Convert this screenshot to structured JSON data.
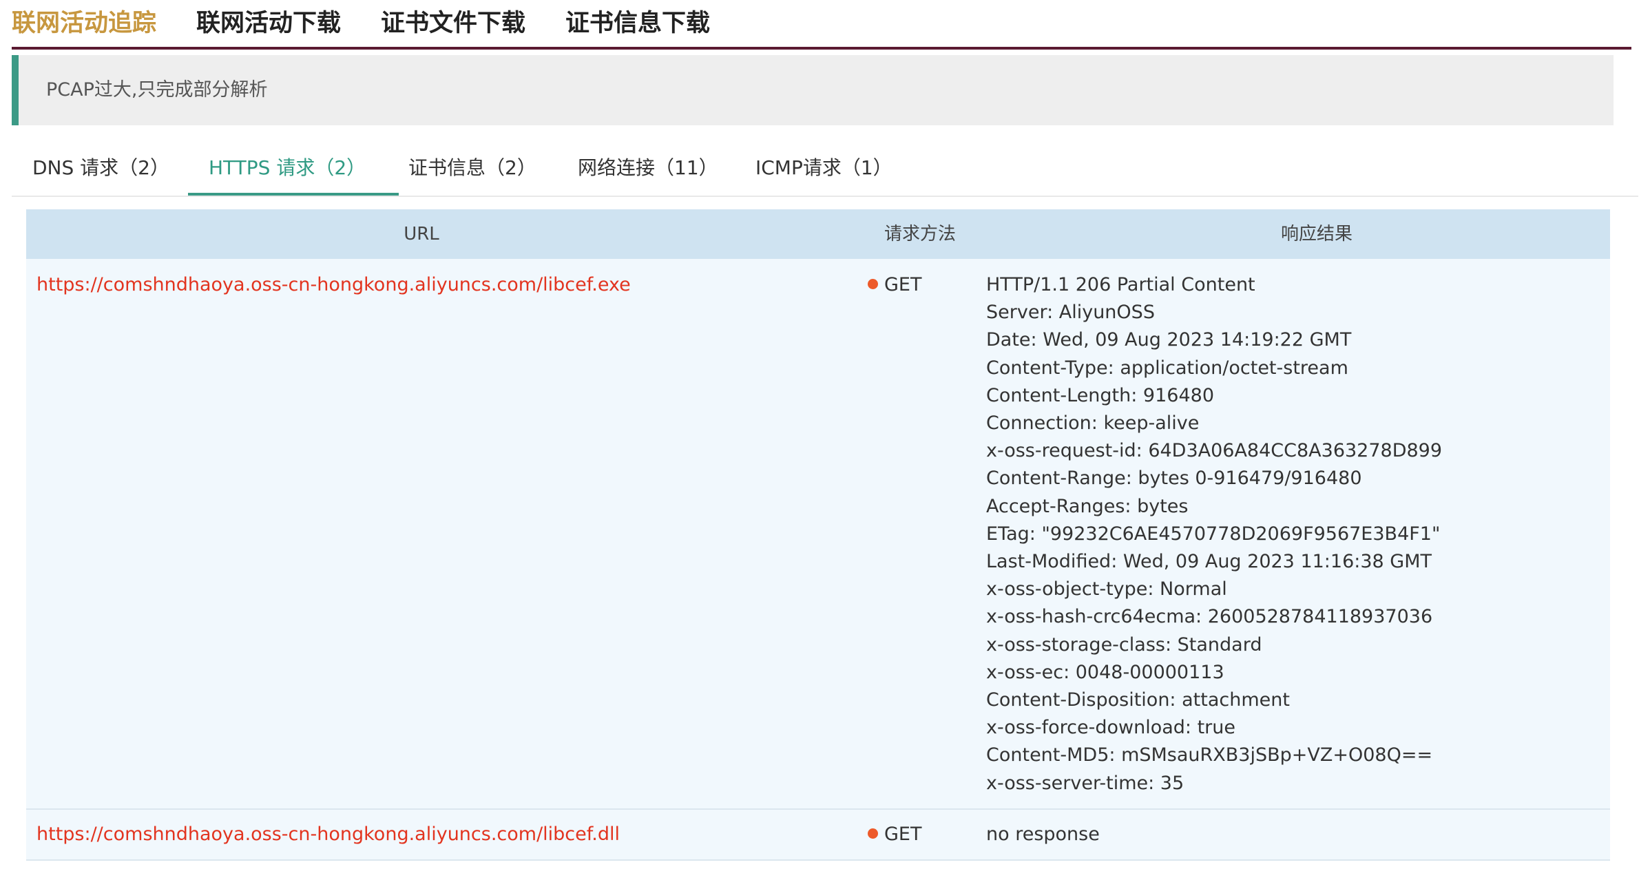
{
  "top_nav": {
    "tabs": [
      {
        "label": "联网活动追踪",
        "color": "#c7973f"
      },
      {
        "label": "联网活动下载"
      },
      {
        "label": "证书文件下载"
      },
      {
        "label": "证书信息下载"
      }
    ]
  },
  "notice": {
    "text": "PCAP过大,只完成部分解析"
  },
  "sub_tabs": {
    "active_index": 1,
    "items": [
      {
        "label": "DNS 请求（2）"
      },
      {
        "label": "HTTPS 请求（2）"
      },
      {
        "label": "证书信息（2）"
      },
      {
        "label": "网络连接（11）"
      },
      {
        "label": "ICMP请求（1）"
      }
    ]
  },
  "table": {
    "headers": {
      "url": "URL",
      "method": "请求方法",
      "response": "响应结果"
    },
    "rows": [
      {
        "url": "https://comshndhaoya.oss-cn-hongkong.aliyuncs.com/libcef.exe",
        "method": "GET",
        "response": [
          "HTTP/1.1 206 Partial Content",
          "Server: AliyunOSS",
          "Date: Wed, 09 Aug 2023 14:19:22 GMT",
          "Content-Type: application/octet-stream",
          "Content-Length: 916480",
          "Connection: keep-alive",
          "x-oss-request-id: 64D3A06A84CC8A363278D899",
          "Content-Range: bytes 0-916479/916480",
          "Accept-Ranges: bytes",
          "ETag: \"99232C6AE4570778D2069F9567E3B4F1\"",
          "Last-Modified: Wed, 09 Aug 2023 11:16:38 GMT",
          "x-oss-object-type: Normal",
          "x-oss-hash-crc64ecma: 2600528784118937036",
          "x-oss-storage-class: Standard",
          "x-oss-ec: 0048-00000113",
          "Content-Disposition: attachment",
          "x-oss-force-download: true",
          "Content-MD5: mSMsauRXB3jSBp+VZ+O08Q==",
          "x-oss-server-time: 35"
        ]
      },
      {
        "url": "https://comshndhaoya.oss-cn-hongkong.aliyuncs.com/libcef.dll",
        "method": "GET",
        "response": [
          "no response"
        ]
      }
    ]
  },
  "colors": {
    "active_tab": "#c7973f",
    "nav_border": "#5b1a32",
    "accent_green": "#3a9a86",
    "url_red": "#e2341f",
    "method_dot": "#ed5a2a",
    "table_header_bg": "#cfe3f1",
    "row_bg": "#f1f8fd"
  }
}
